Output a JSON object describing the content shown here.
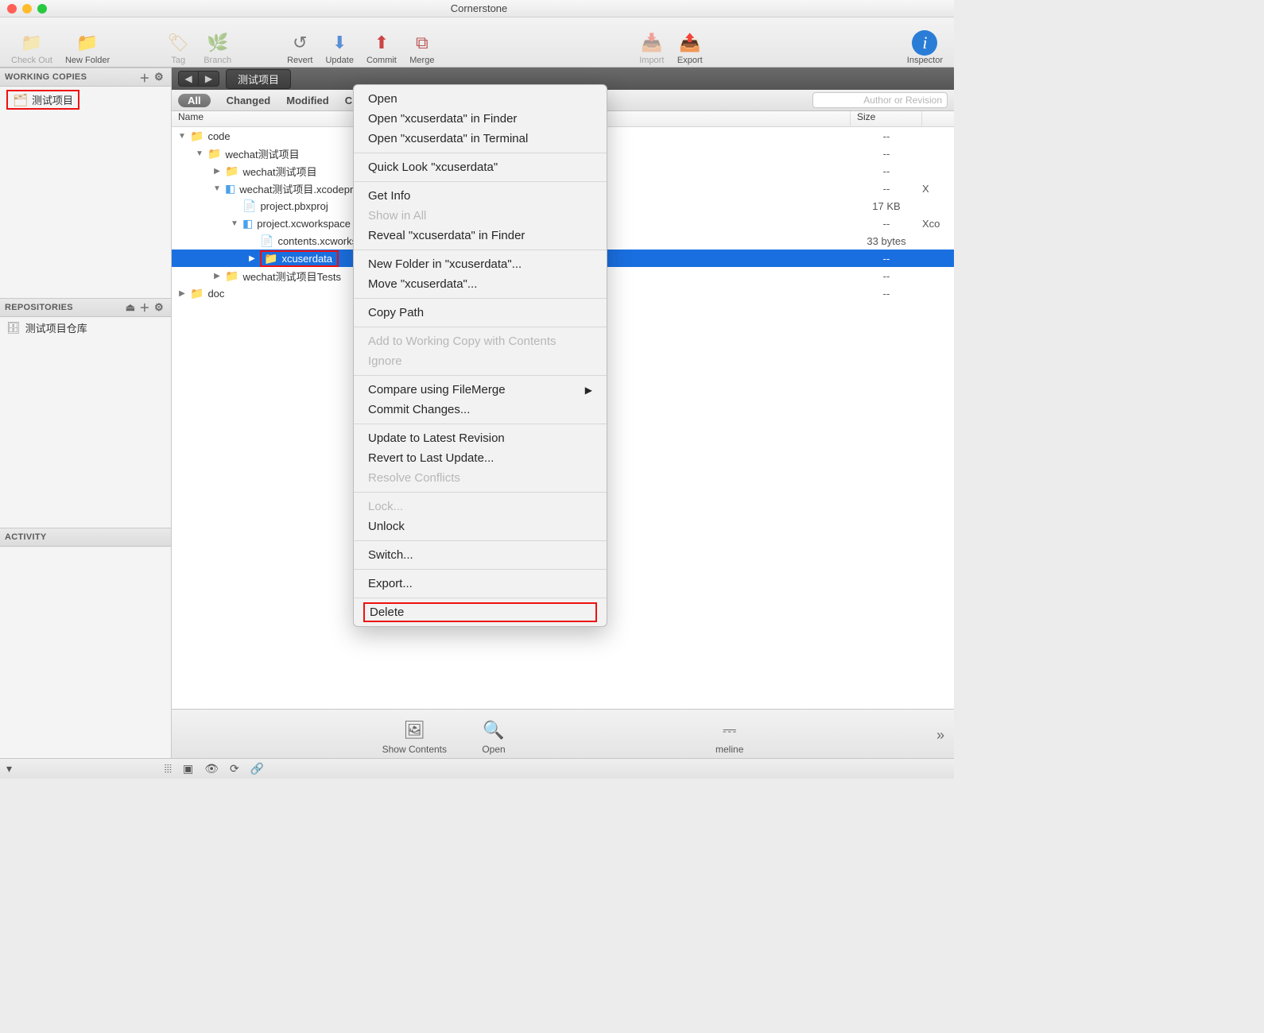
{
  "window": {
    "title": "Cornerstone"
  },
  "toolbar": {
    "checkout": "Check Out",
    "newfolder": "New Folder",
    "tag": "Tag",
    "branch": "Branch",
    "revert": "Revert",
    "update": "Update",
    "commit": "Commit",
    "merge": "Merge",
    "import": "Import",
    "export": "Export",
    "inspector": "Inspector"
  },
  "sidebar": {
    "working_copies_header": "WORKING COPIES",
    "wc_item": "测试项目",
    "repositories_header": "REPOSITORIES",
    "repo_item": "测试项目仓库",
    "activity_header": "ACTIVITY"
  },
  "breadcrumb": "测试项目",
  "filter": {
    "all": "All",
    "changed": "Changed",
    "modified": "Modified",
    "c_partial": "C",
    "search_placeholder": "Author or Revision"
  },
  "table": {
    "name": "Name",
    "size": "Size"
  },
  "tree": {
    "code": "code",
    "wechat_proj": "wechat测试项目",
    "wechat_proj_inner": "wechat测试项目",
    "xcodeproj": "wechat测试项目.xcodepr",
    "pbxproj": "project.pbxproj",
    "pbxproj_size": "17 KB",
    "xcworkspace": "project.xcworkspace",
    "xcworkspace_kind": "Xco",
    "contents": "contents.xcworksp",
    "contents_size": "33 bytes",
    "xcuserdata": "xcuserdata",
    "tests": "wechat测试项目Tests",
    "doc": "doc",
    "dash": "--"
  },
  "mainfoot": {
    "show_contents": "Show Contents",
    "open": "Open",
    "timeline": "meline"
  },
  "ctx": {
    "open": "Open",
    "open_finder": "Open \"xcuserdata\" in Finder",
    "open_terminal": "Open \"xcuserdata\" in Terminal",
    "quicklook": "Quick Look \"xcuserdata\"",
    "getinfo": "Get Info",
    "showinall": "Show in All",
    "reveal": "Reveal \"xcuserdata\" in Finder",
    "newfolder": "New Folder in \"xcuserdata\"...",
    "move": "Move \"xcuserdata\"...",
    "copypath": "Copy Path",
    "addwc": "Add to Working Copy with Contents",
    "ignore": "Ignore",
    "compare": "Compare using FileMerge",
    "commit": "Commit Changes...",
    "updatelatest": "Update to Latest Revision",
    "revertlast": "Revert to Last Update...",
    "resolve": "Resolve Conflicts",
    "lock": "Lock...",
    "unlock": "Unlock",
    "switch": "Switch...",
    "export": "Export...",
    "delete": "Delete"
  }
}
